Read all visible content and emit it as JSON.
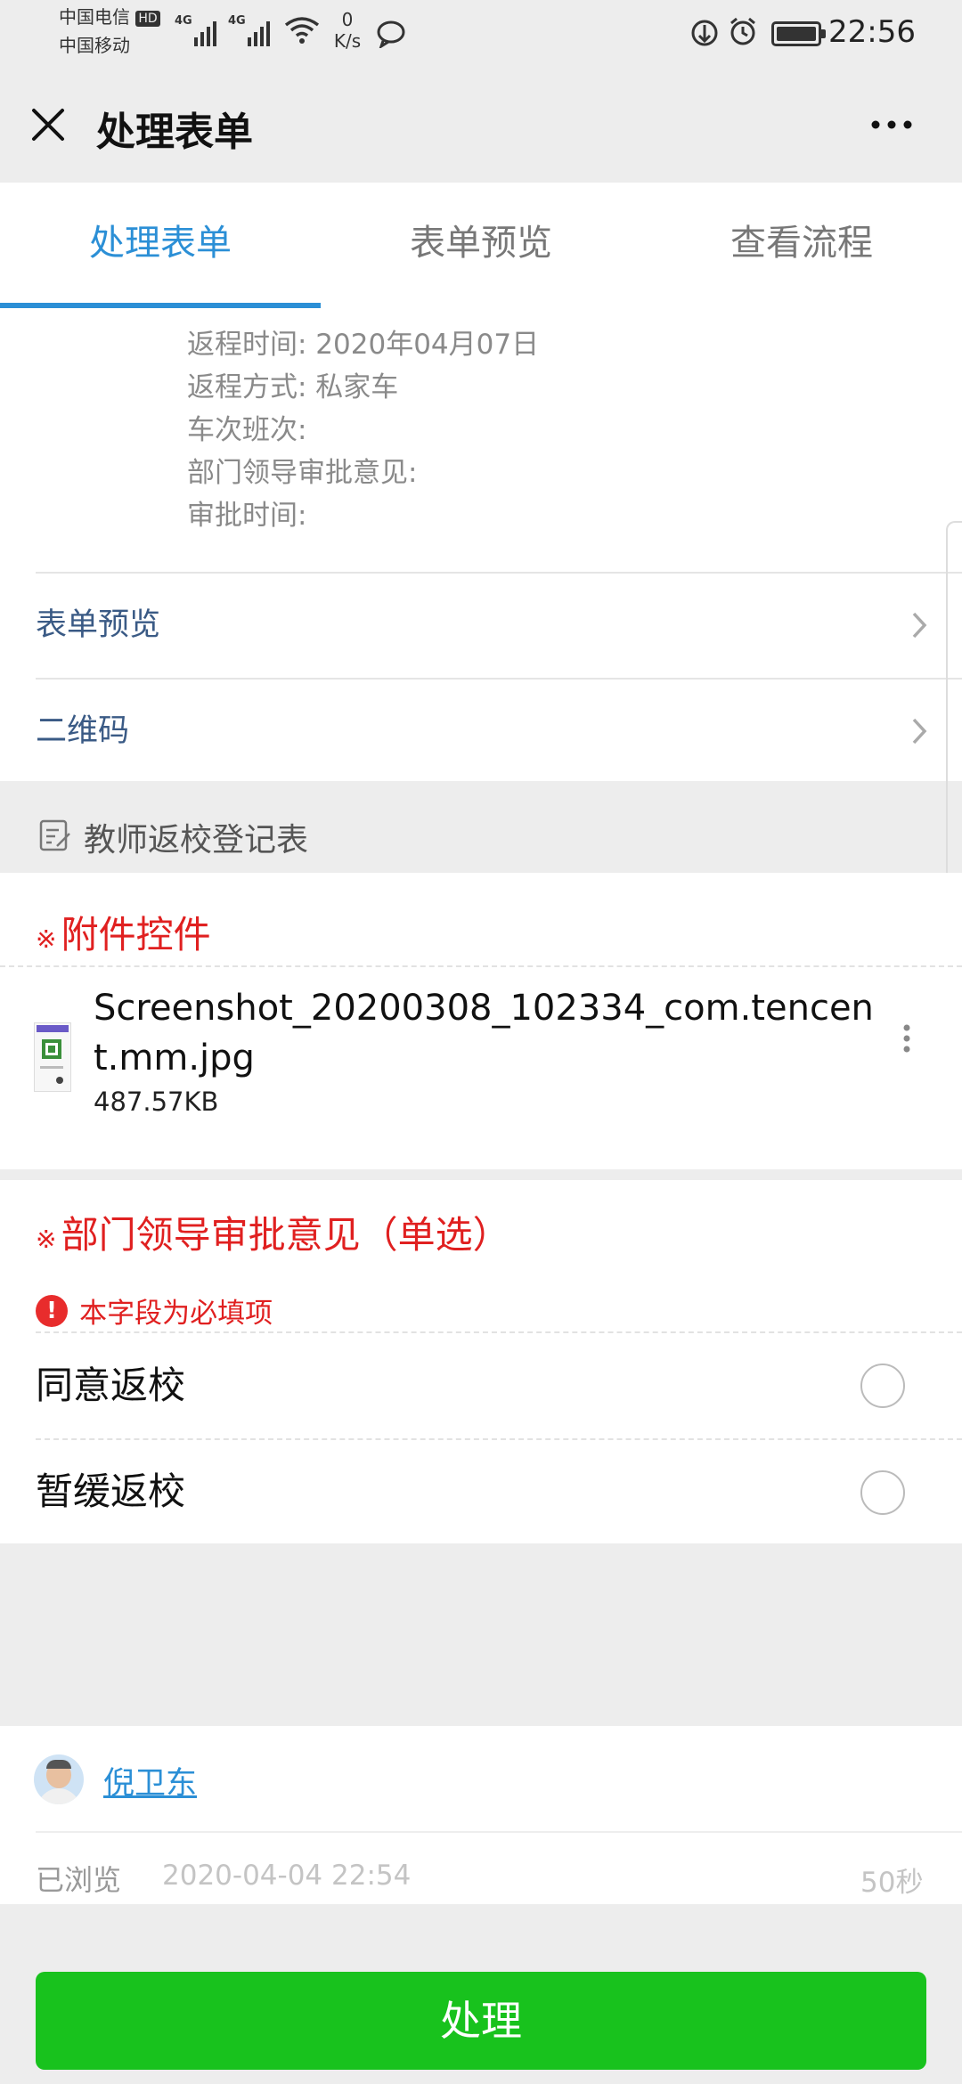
{
  "status_bar": {
    "carrier1": "中国电信",
    "carrier1_badge": "HD",
    "carrier2": "中国移动",
    "network1": "4G",
    "network2": "4G",
    "speed_value": "0",
    "speed_unit": "K/s",
    "time": "22:56"
  },
  "header": {
    "title": "处理表单"
  },
  "tabs": [
    {
      "label": "处理表单",
      "active": true
    },
    {
      "label": "表单预览",
      "active": false
    },
    {
      "label": "查看流程",
      "active": false
    }
  ],
  "info": {
    "lines": [
      "返程时间: 2020年04月07日",
      "返程方式: 私家车",
      "车次班次:",
      "部门领导审批意见:",
      "审批时间:"
    ]
  },
  "links": {
    "form_preview": "表单预览",
    "qr_code": "二维码"
  },
  "section": {
    "title": "教师返校登记表"
  },
  "attachment": {
    "required_mark": "※",
    "label": "附件控件",
    "file_name": "Screenshot_20200308_102334_com.tencent.mm.jpg",
    "file_size": "487.57KB"
  },
  "approval": {
    "required_mark": "※",
    "label": "部门领导审批意见（单选）",
    "error_text": "本字段为必填项",
    "options": [
      {
        "label": "同意返校",
        "selected": false
      },
      {
        "label": "暂缓返校",
        "selected": false
      }
    ]
  },
  "viewer": {
    "name": "倪卫东",
    "status": "已浏览",
    "datetime": "2020-04-04 22:54",
    "duration": "50秒"
  },
  "action": {
    "button_label": "处理"
  },
  "colors": {
    "accent_blue": "#2b8fd6",
    "required_red": "#e02020",
    "action_green": "#18c21d",
    "link_blue": "#3a5a85"
  }
}
